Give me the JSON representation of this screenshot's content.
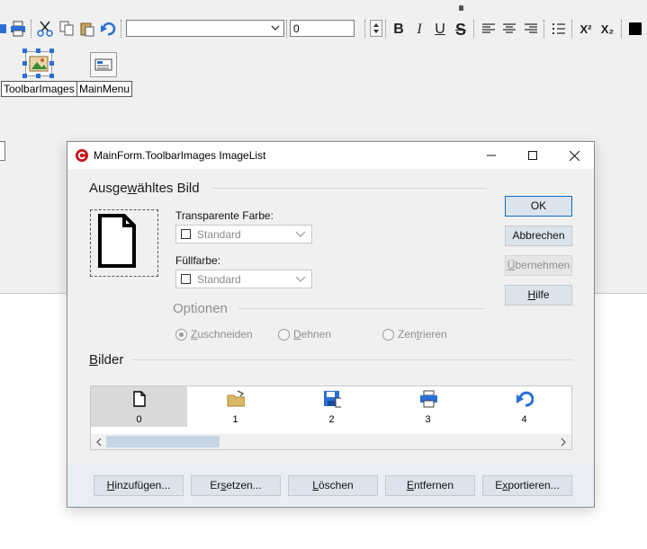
{
  "ide": {
    "font_combo_value": "",
    "size_combo_value": "0",
    "components": [
      {
        "label": "ToolbarImages"
      },
      {
        "label": "MainMenu"
      }
    ]
  },
  "dialog": {
    "title": "MainForm.ToolbarImages ImageList",
    "selected_group": {
      "before": "Ausge",
      "accel": "w",
      "after": "ähltes Bild"
    },
    "transparent_label": "Transparente Farbe:",
    "transparent_value": "Standard",
    "fill_label": "Füllfarbe:",
    "fill_value": "Standard",
    "options_title": "Optionen",
    "radios": [
      {
        "accel": "Z",
        "rest": "uschneiden",
        "checked": true
      },
      {
        "accel": "D",
        "rest": "ehnen",
        "checked": false
      },
      {
        "pre": "Zen",
        "accel": "t",
        "rest": "rieren",
        "checked": false
      }
    ],
    "images_group": {
      "accel": "B",
      "rest": "ilder"
    },
    "images": [
      "0",
      "1",
      "2",
      "3",
      "4"
    ],
    "buttons": {
      "ok": "OK",
      "cancel": "Abbrechen",
      "apply": {
        "accel": "Ü",
        "rest": "bernehmen"
      },
      "help": {
        "accel": "H",
        "rest": "ilfe"
      }
    },
    "footer_buttons": {
      "add": {
        "accel": "H",
        "rest": "inzufügen..."
      },
      "replace": {
        "pre": "Er",
        "accel": "s",
        "rest": "etzen..."
      },
      "delete": {
        "accel": "L",
        "rest": "öschen"
      },
      "remove": {
        "accel": "E",
        "rest": "ntfernen"
      },
      "export": {
        "pre": "E",
        "accel": "x",
        "rest": "portieren..."
      }
    }
  },
  "colors": {
    "accent": "#0a6fc2",
    "button_bg": "#dbe4ec",
    "footer_bg": "#e8eef4",
    "selection": "#d9d9d9"
  }
}
